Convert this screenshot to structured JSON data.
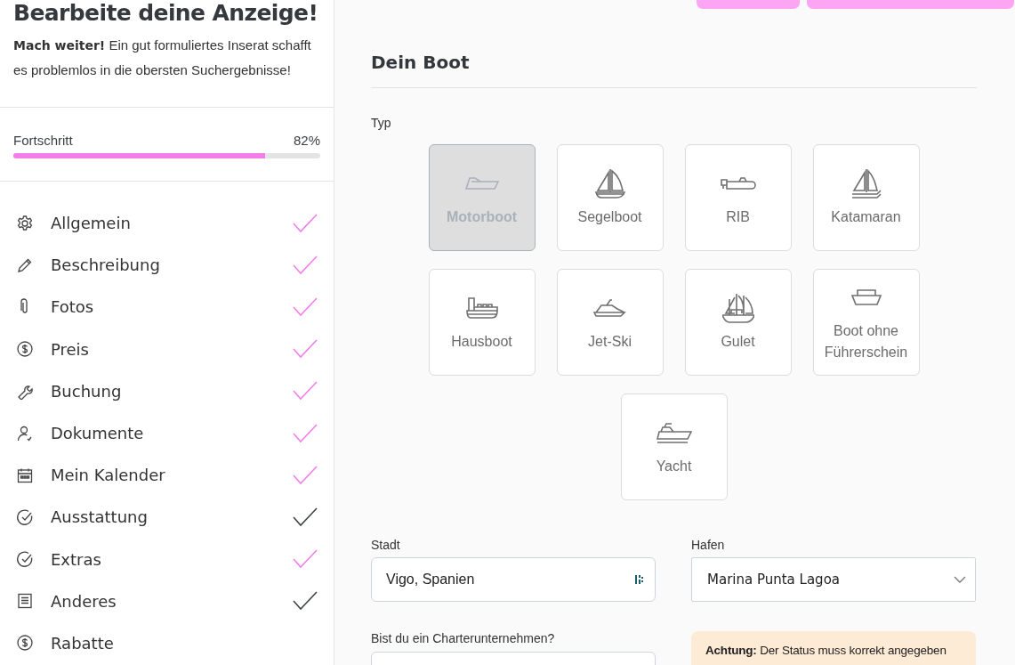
{
  "sidebar": {
    "title": "Bearbeite deine Anzeige!",
    "intro": "**Mach weiter!** Ein gut formuliertes Inserat schafft es problemlos in die obersten Suchergebnisse!",
    "progress": {
      "label": "Fortschritt",
      "reading": "82%",
      "level": 0.82
    },
    "items": [
      {
        "label": "Allgemein",
        "kind": "gear",
        "checked": true,
        "color": "#f37ee8"
      },
      {
        "label": "Beschreibung",
        "kind": "pencil",
        "checked": true,
        "color": "#f37ee8"
      },
      {
        "label": "Fotos",
        "kind": "paperclip",
        "checked": true,
        "color": "#f37ee8"
      },
      {
        "label": "Preis",
        "kind": "dollar",
        "checked": true,
        "color": "#f37ee8"
      },
      {
        "label": "Buchung",
        "kind": "wrench",
        "checked": true,
        "color": "#f37ee8"
      },
      {
        "label": "Dokumente",
        "kind": "user",
        "checked": true,
        "color": "#f37ee8"
      },
      {
        "label": "Mein Kalender",
        "kind": "calendar",
        "checked": true,
        "color": "#f37ee8"
      },
      {
        "label": "Ausstattung",
        "kind": "circlecheck",
        "checked": true,
        "color": "#3f4448"
      },
      {
        "label": "Extras",
        "kind": "circlecheck",
        "checked": true,
        "color": "#f37ee8"
      },
      {
        "label": "Anderes",
        "kind": "document",
        "checked": true,
        "color": "#3f4448"
      },
      {
        "label": "Rabatte",
        "kind": "dollar",
        "checked": false
      }
    ]
  },
  "main": {
    "section_title": "Dein Boot",
    "type_label": "Typ",
    "types": [
      {
        "label": "Motorboot",
        "kind": "motorboat",
        "selected": true
      },
      {
        "label": "Segelboot",
        "kind": "sailboat",
        "selected": false
      },
      {
        "label": "RIB",
        "kind": "rib",
        "selected": false
      },
      {
        "label": "Katamaran",
        "kind": "catamaran",
        "selected": false
      },
      {
        "label": "Hausboot",
        "kind": "houseboat",
        "selected": false
      },
      {
        "label": "Jet-Ski",
        "kind": "jetski",
        "selected": false
      },
      {
        "label": "Gulet",
        "kind": "gulet",
        "selected": false
      },
      {
        "label": "Boot ohne Führerschein",
        "kind": "smallboat",
        "selected": false
      },
      {
        "label": "Yacht",
        "kind": "yacht",
        "selected": false
      }
    ],
    "city": {
      "label": "Stadt",
      "value": "Vigo, Spanien"
    },
    "harbor": {
      "label": "Hafen",
      "value": "Marina Punta Lagoa"
    },
    "charter": {
      "label": "Bist du ein Charterunternehmen?"
    },
    "notice": "**Achtung:** Der Status muss korrekt angegeben"
  }
}
